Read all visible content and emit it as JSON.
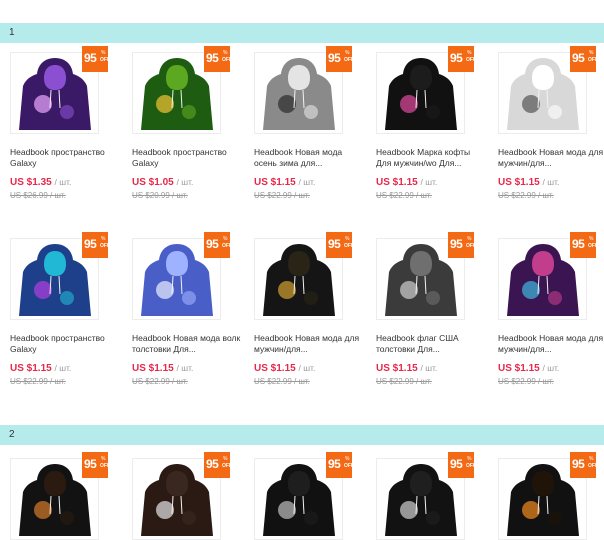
{
  "sections": [
    "1",
    "2"
  ],
  "products": [
    {
      "title": "Headbook пространство Galaxy",
      "price": "US $1.35",
      "unit": "/ шт.",
      "old_price": "US $26.99 / шт.",
      "badge": {
        "pct": "95",
        "percent": "%",
        "off": "OFF"
      },
      "colors": [
        "#3a1a66",
        "#8b4fd1",
        "#e9a6ff"
      ]
    },
    {
      "title": "Headbook пространство Galaxy",
      "price": "US $1.05",
      "unit": "/ шт.",
      "old_price": "US $20.99 / шт.",
      "badge": {
        "pct": "95",
        "percent": "%",
        "off": "OFF"
      },
      "colors": [
        "#1e5c12",
        "#5da821",
        "#f4c534"
      ]
    },
    {
      "title": "Headbook Новая мода осень зима для...",
      "price": "US $1.15",
      "unit": "/ шт.",
      "old_price": "US $22.99 / шт.",
      "badge": {
        "pct": "95",
        "percent": "%",
        "off": "OFF"
      },
      "colors": [
        "#8a8a8a",
        "#e4e4e4",
        "#2b2b2b"
      ]
    },
    {
      "title": "Headbook Марка кофты Для мужчин/wo Для...",
      "price": "US $1.15",
      "unit": "/ шт.",
      "old_price": "US $22.99 / шт.",
      "badge": {
        "pct": "95",
        "percent": "%",
        "off": "OFF"
      },
      "colors": [
        "#111111",
        "#1c1c1c",
        "#e04aa0"
      ]
    },
    {
      "title": "Headbook Новая мода для мужчин/для...",
      "price": "US $1.15",
      "unit": "/ шт.",
      "old_price": "US $22.99 / шт.",
      "badge": {
        "pct": "95",
        "percent": "%",
        "off": "OFF"
      },
      "colors": [
        "#d8d8d8",
        "#ffffff",
        "#555555"
      ]
    },
    {
      "title": "Headbook пространство Galaxy",
      "price": "US $1.15",
      "unit": "/ шт.",
      "old_price": "US $22.99 / шт.",
      "badge": {
        "pct": "95",
        "percent": "%",
        "off": "OFF"
      },
      "colors": [
        "#1e3f8a",
        "#21b8d6",
        "#b23fe0"
      ]
    },
    {
      "title": "Headbook Новая мода волк толстовки Для...",
      "price": "US $1.15",
      "unit": "/ шт.",
      "old_price": "US $22.99 / шт.",
      "badge": {
        "pct": "95",
        "percent": "%",
        "off": "OFF"
      },
      "colors": [
        "#4a5ec8",
        "#9fb2ff",
        "#e9efff"
      ]
    },
    {
      "title": "Headbook Новая мода для мужчин/для...",
      "price": "US $1.15",
      "unit": "/ шт.",
      "old_price": "US $22.99 / шт.",
      "badge": {
        "pct": "95",
        "percent": "%",
        "off": "OFF"
      },
      "colors": [
        "#151515",
        "#2a2416",
        "#d1a031"
      ]
    },
    {
      "title": "Headbook флаг США толстовки Для...",
      "price": "US $1.15",
      "unit": "/ шт.",
      "old_price": "US $22.99 / шт.",
      "badge": {
        "pct": "95",
        "percent": "%",
        "off": "OFF"
      },
      "colors": [
        "#3b3b3b",
        "#6f6f6f",
        "#cfcfcf"
      ]
    },
    {
      "title": "Headbook Новая мода для мужчин/для...",
      "price": "US $1.15",
      "unit": "/ шт.",
      "old_price": "US $22.99 / шт.",
      "badge": {
        "pct": "95",
        "percent": "%",
        "off": "OFF"
      },
      "colors": [
        "#3b1452",
        "#c23d8c",
        "#3fb8e0"
      ]
    },
    {
      "badge": {
        "pct": "95",
        "percent": "%",
        "off": "OFF"
      },
      "colors": [
        "#121212",
        "#2a1a10",
        "#d67a2a"
      ]
    },
    {
      "badge": {
        "pct": "95",
        "percent": "%",
        "off": "OFF"
      },
      "colors": [
        "#2b1a14",
        "#3a2820",
        "#e6e6e6"
      ]
    },
    {
      "badge": {
        "pct": "95",
        "percent": "%",
        "off": "OFF"
      },
      "colors": [
        "#111111",
        "#1e1e1e",
        "#bfbfbf"
      ]
    },
    {
      "badge": {
        "pct": "95",
        "percent": "%",
        "off": "OFF"
      },
      "colors": [
        "#121212",
        "#1f1f1f",
        "#d0d0d0"
      ]
    },
    {
      "badge": {
        "pct": "95",
        "percent": "%",
        "off": "OFF"
      },
      "colors": [
        "#111111",
        "#201408",
        "#f08a1e"
      ]
    }
  ]
}
